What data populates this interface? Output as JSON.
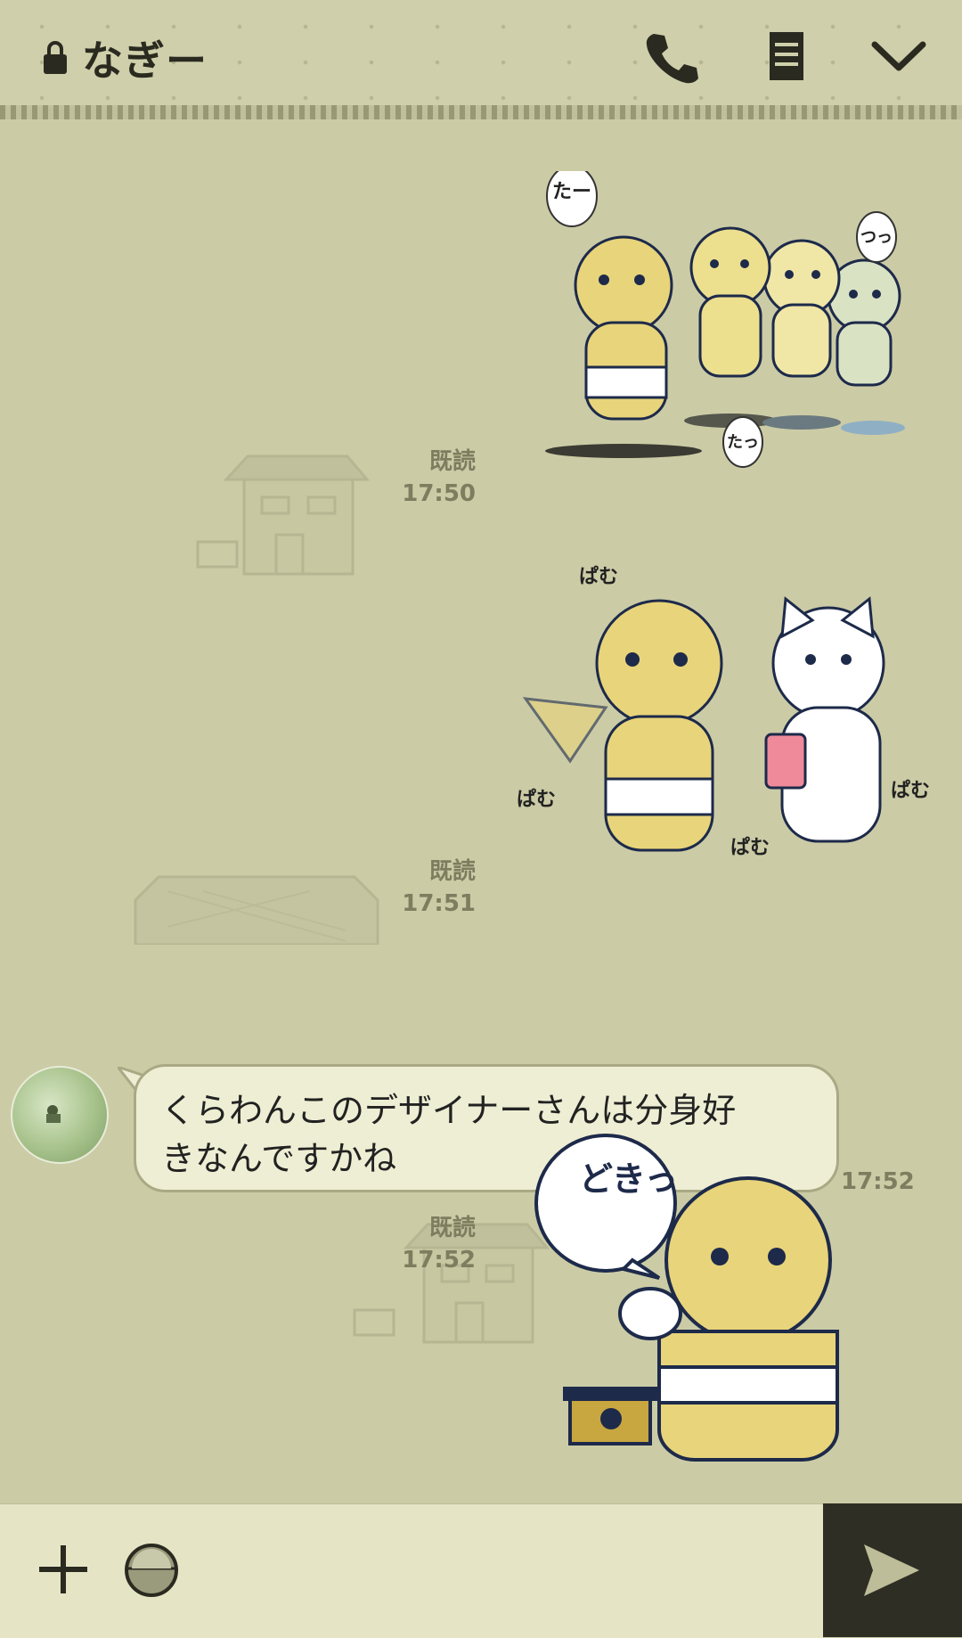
{
  "header": {
    "title": "なぎー",
    "icons": [
      "lock-icon",
      "phone-icon",
      "notes-icon",
      "chevron-down-icon"
    ]
  },
  "messages": [
    {
      "type": "sticker",
      "sender": "me",
      "sticker_text": [
        "たー",
        "つっ",
        "たっ"
      ],
      "read": "既読",
      "time": "17:50"
    },
    {
      "type": "sticker",
      "sender": "me",
      "sticker_text": [
        "ぱむ",
        "ぱむ",
        "ぱむ",
        "ぱむ"
      ],
      "read": "既読",
      "time": "17:51"
    },
    {
      "type": "text",
      "sender": "other",
      "text_line1": "くらわんこのデザイナーさんは分身好",
      "text_line2": "きなんですかね",
      "time": "17:52"
    },
    {
      "type": "sticker",
      "sender": "me",
      "sticker_text": [
        "どきっ"
      ],
      "read": "既読",
      "time": "17:52"
    }
  ],
  "colors": {
    "background": "#cbcba6",
    "bubble": "#eeeed4",
    "dog": "#e8d47a",
    "outline": "#1d2a4a"
  }
}
